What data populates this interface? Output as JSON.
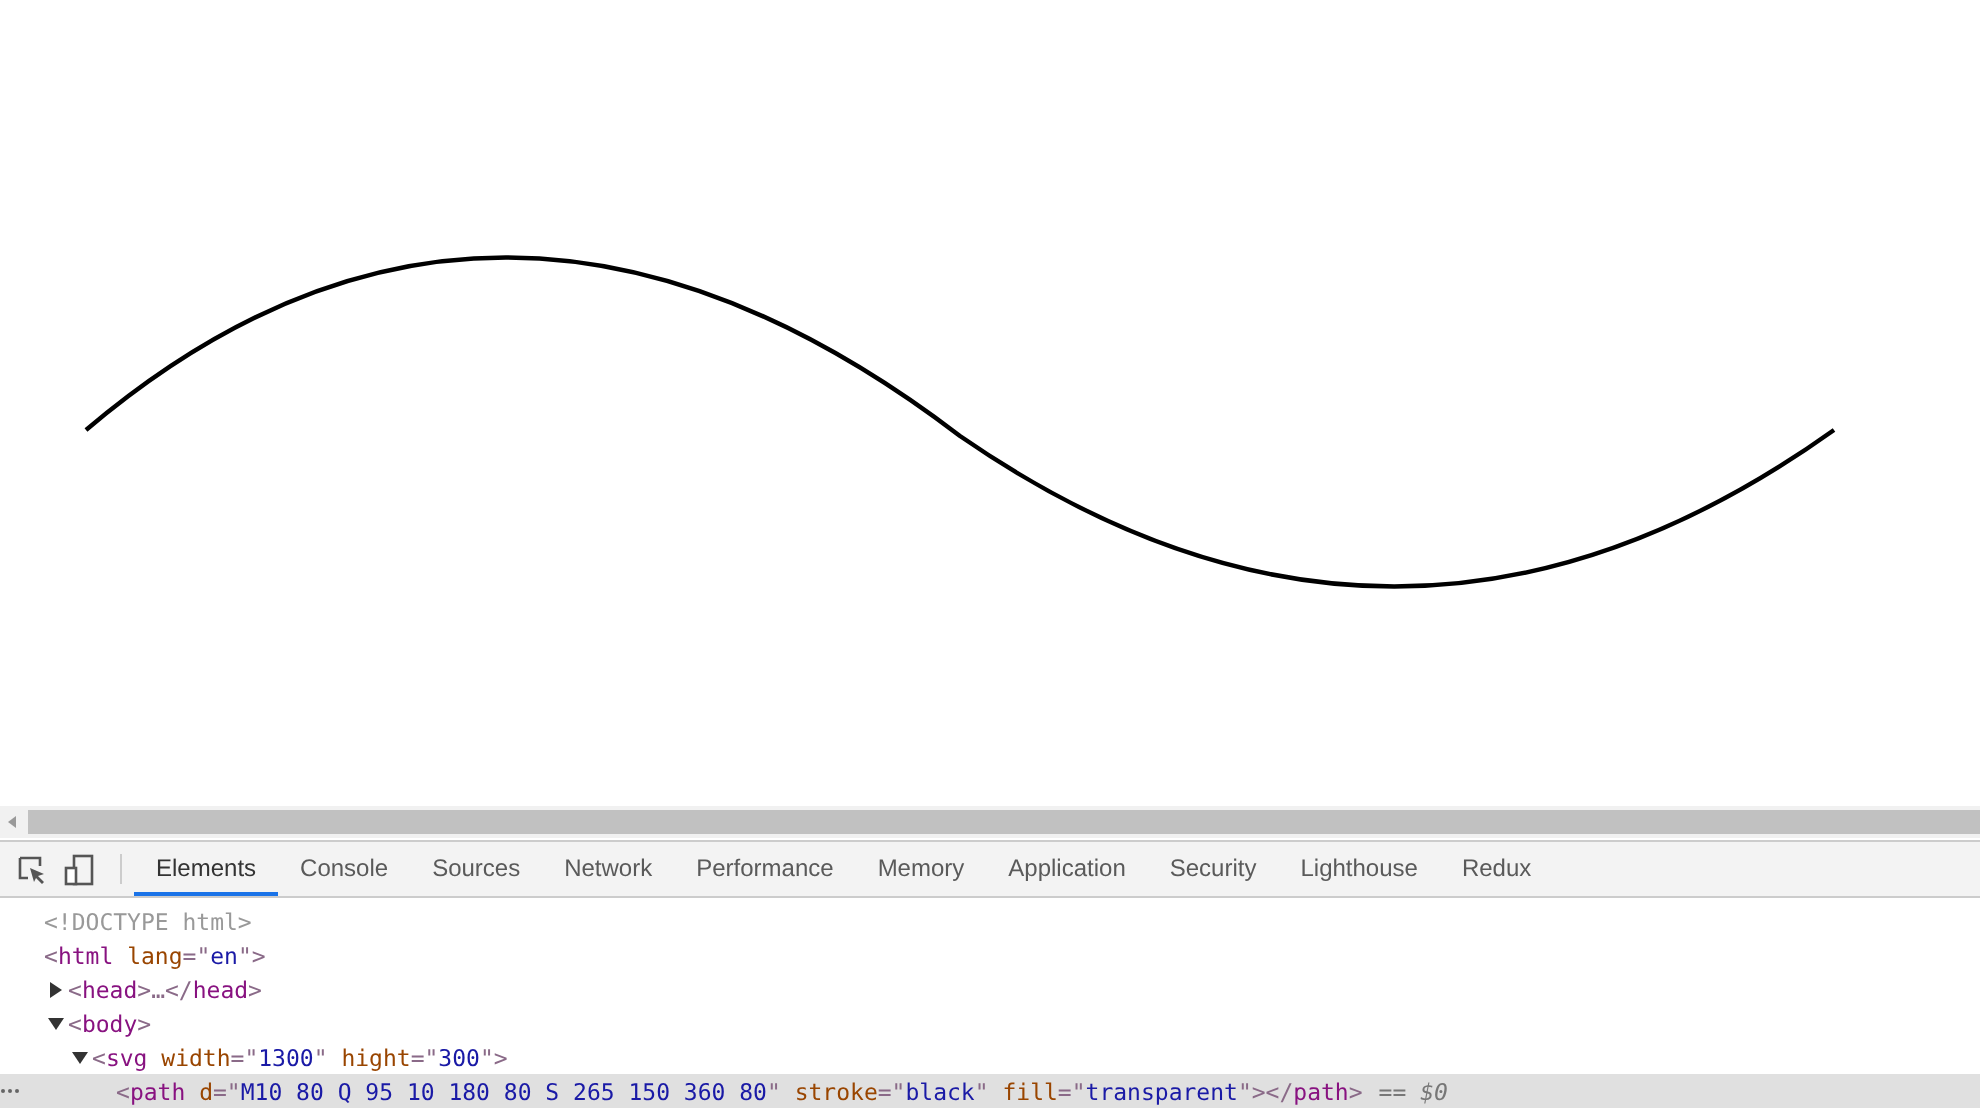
{
  "devtools": {
    "tabs": [
      {
        "label": "Elements",
        "selected": true
      },
      {
        "label": "Console",
        "selected": false
      },
      {
        "label": "Sources",
        "selected": false
      },
      {
        "label": "Network",
        "selected": false
      },
      {
        "label": "Performance",
        "selected": false
      },
      {
        "label": "Memory",
        "selected": false
      },
      {
        "label": "Application",
        "selected": false
      },
      {
        "label": "Security",
        "selected": false
      },
      {
        "label": "Lighthouse",
        "selected": false
      },
      {
        "label": "Redux",
        "selected": false
      }
    ],
    "dom_tree": [
      {
        "tokens": [
          {
            "kind": "doctype",
            "text": "<!DOCTYPE html>"
          }
        ],
        "selected": false
      },
      {
        "tokens": [
          {
            "kind": "punct",
            "text": "<"
          },
          {
            "kind": "tag",
            "text": "html"
          },
          {
            "kind": "attr",
            "text": " lang"
          },
          {
            "kind": "punct",
            "text": "=\""
          },
          {
            "kind": "value",
            "text": "en"
          },
          {
            "kind": "punct",
            "text": "\">"
          }
        ],
        "selected": false,
        "children": [
          {
            "tokens": [
              {
                "kind": "punct",
                "text": "<"
              },
              {
                "kind": "tag",
                "text": "head"
              },
              {
                "kind": "punct",
                "text": ">…</"
              },
              {
                "kind": "tag",
                "text": "head"
              },
              {
                "kind": "punct",
                "text": ">"
              }
            ],
            "expanded": false,
            "selected": false
          },
          {
            "tokens": [
              {
                "kind": "punct",
                "text": "<"
              },
              {
                "kind": "tag",
                "text": "body"
              },
              {
                "kind": "punct",
                "text": ">"
              }
            ],
            "expanded": true,
            "selected": false,
            "children": [
              {
                "tokens": [
                  {
                    "kind": "punct",
                    "text": "<"
                  },
                  {
                    "kind": "tag",
                    "text": "svg"
                  },
                  {
                    "kind": "attr",
                    "text": " width"
                  },
                  {
                    "kind": "punct",
                    "text": "=\""
                  },
                  {
                    "kind": "value",
                    "text": "1300"
                  },
                  {
                    "kind": "punct",
                    "text": "\""
                  },
                  {
                    "kind": "attr",
                    "text": " hight"
                  },
                  {
                    "kind": "punct",
                    "text": "=\""
                  },
                  {
                    "kind": "value",
                    "text": "300"
                  },
                  {
                    "kind": "punct",
                    "text": "\">"
                  }
                ],
                "expanded": true,
                "selected": false,
                "children": [
                  {
                    "tokens": [
                      {
                        "kind": "punct",
                        "text": "<"
                      },
                      {
                        "kind": "tag",
                        "text": "path"
                      },
                      {
                        "kind": "attr",
                        "text": " d"
                      },
                      {
                        "kind": "punct",
                        "text": "=\""
                      },
                      {
                        "kind": "value",
                        "text": "M10 80 Q 95 10 180 80 S 265 150 360 80"
                      },
                      {
                        "kind": "punct",
                        "text": "\""
                      },
                      {
                        "kind": "attr",
                        "text": " stroke"
                      },
                      {
                        "kind": "punct",
                        "text": "=\""
                      },
                      {
                        "kind": "value",
                        "text": "black"
                      },
                      {
                        "kind": "punct",
                        "text": "\""
                      },
                      {
                        "kind": "attr",
                        "text": " fill"
                      },
                      {
                        "kind": "punct",
                        "text": "=\""
                      },
                      {
                        "kind": "value",
                        "text": "transparent"
                      },
                      {
                        "kind": "punct",
                        "text": "\"></"
                      },
                      {
                        "kind": "tag",
                        "text": "path"
                      },
                      {
                        "kind": "punct",
                        "text": ">"
                      }
                    ],
                    "selected": true,
                    "selection_marker": "== $0"
                  }
                ]
              }
            ]
          }
        ]
      }
    ]
  }
}
